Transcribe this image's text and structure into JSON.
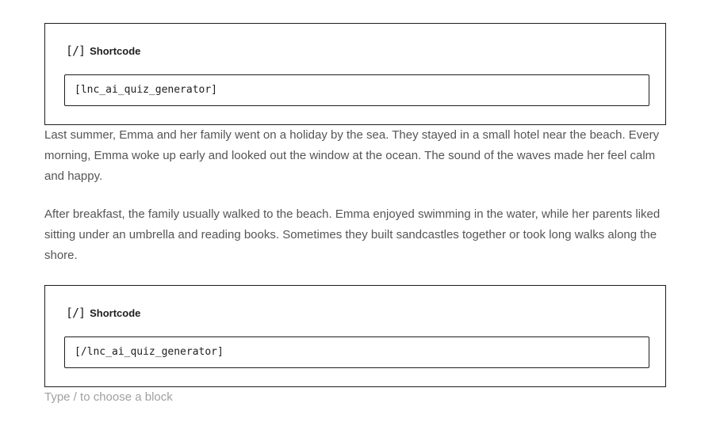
{
  "blocks": [
    {
      "icon": "[/]",
      "label": "Shortcode",
      "value": "[lnc_ai_quiz_generator]"
    },
    {
      "icon": "[/]",
      "label": "Shortcode",
      "value": "[/lnc_ai_quiz_generator]"
    }
  ],
  "paragraphs": [
    "Last summer, Emma and her family went on a holiday by the sea. They stayed in a small hotel near the beach. Every morning, Emma woke up early and looked out the window at the ocean. The sound of the waves made her feel calm and happy.",
    "After breakfast, the family usually walked to the beach. Emma enjoyed swimming in the water, while her parents liked sitting under an umbrella and reading books. Sometimes they built sandcastles together or took long walks along the shore."
  ],
  "appender": {
    "placeholder": "Type / to choose a block"
  }
}
